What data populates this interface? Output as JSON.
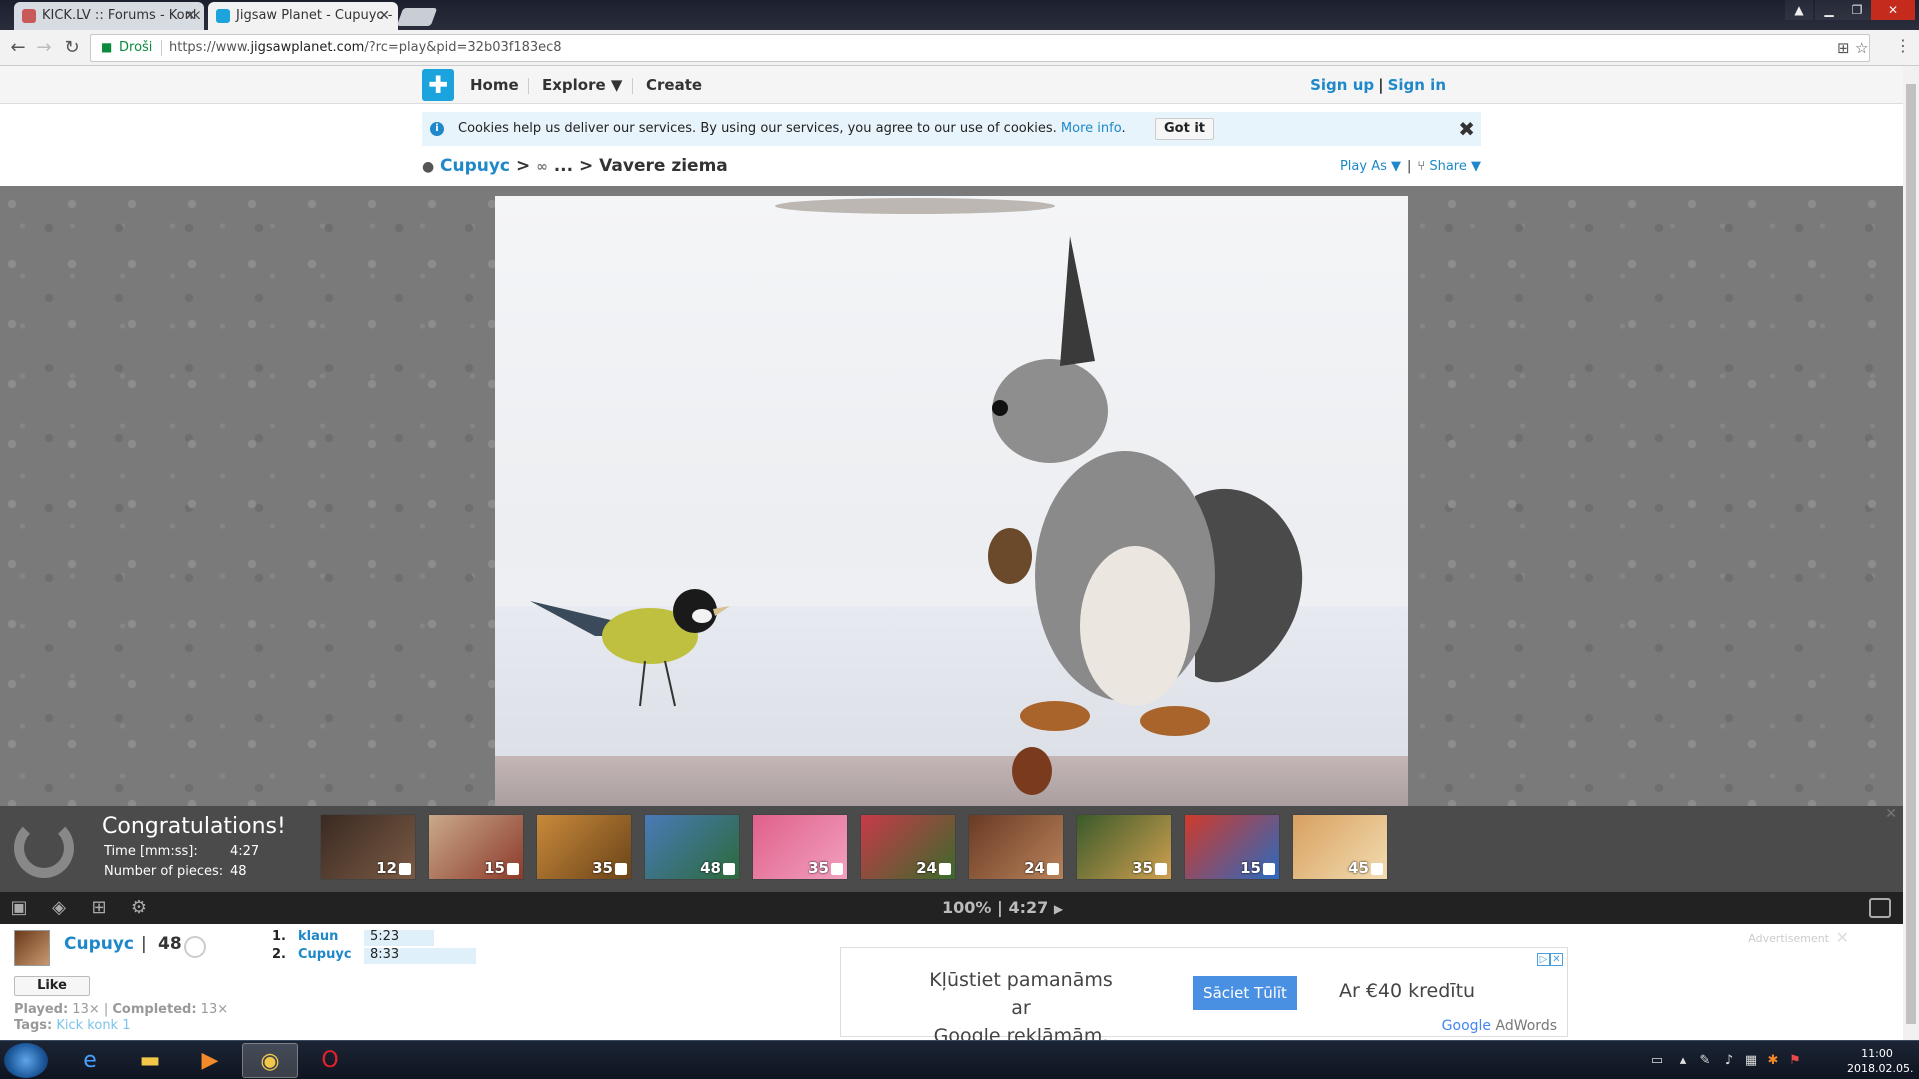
{
  "browser": {
    "tabs": [
      {
        "title": "KICK.LV :: Forums - Konk",
        "active": false
      },
      {
        "title": "Jigsaw Planet - Cupuyc - ",
        "active": true
      }
    ],
    "secure_label": "Droši",
    "url_prefix": "https://www.",
    "url_host": "jigsawplanet.com",
    "url_path": "/?rc=play&pid=32b03f183ec8"
  },
  "site": {
    "nav": {
      "home": "Home",
      "explore": "Explore ▼",
      "create": "Create"
    },
    "auth": {
      "sign_up": "Sign up",
      "separator": "|",
      "sign_in": "Sign in"
    }
  },
  "cookie": {
    "text": "Cookies help us deliver our services. By using our services, you agree to our use of cookies.",
    "more": "More info",
    "more_suffix": ".",
    "button": "Got it",
    "close": "✖"
  },
  "breadcrumb": {
    "user": "Cupuyc",
    "gt1": ">",
    "ellipsis": "...",
    "gt2": ">",
    "title": "Vavere ziema",
    "play_as": "Play As ▼",
    "separator": "|",
    "share": "Share ▼"
  },
  "congrats": {
    "title": "Congratulations!",
    "time_label": "Time [mm:ss]:",
    "time_value": "4:27",
    "pieces_label": "Number of pieces:",
    "pieces_value": "48",
    "thumbnails": [
      {
        "count": "12",
        "colors": [
          "#3a2a22",
          "#7a5a44"
        ]
      },
      {
        "count": "15",
        "colors": [
          "#caa98a",
          "#8c3a2a"
        ]
      },
      {
        "count": "35",
        "colors": [
          "#c98a3a",
          "#6a4318"
        ]
      },
      {
        "count": "48",
        "colors": [
          "#4a7ab8",
          "#2a6a3a"
        ]
      },
      {
        "count": "35",
        "colors": [
          "#e0608a",
          "#f2a0c0"
        ]
      },
      {
        "count": "24",
        "colors": [
          "#c83a4a",
          "#3a6a2a"
        ]
      },
      {
        "count": "24",
        "colors": [
          "#6a3a24",
          "#b8825a"
        ]
      },
      {
        "count": "35",
        "colors": [
          "#3a5a2a",
          "#d0a050"
        ]
      },
      {
        "count": "15",
        "colors": [
          "#d03a2a",
          "#2a6ac0"
        ]
      },
      {
        "count": "45",
        "colors": [
          "#d8a060",
          "#f2dcb0"
        ]
      }
    ]
  },
  "toolbar": {
    "zoom": "100%",
    "separator": "|",
    "timer": "4:27",
    "play": "▶"
  },
  "info": {
    "owner": "Cupuyc",
    "separator": "|",
    "puzzle_count": "48",
    "like": "Like",
    "played_label": "Played:",
    "played_value": "13×",
    "completed_label": "Completed:",
    "completed_value": "13×",
    "tags_label": "Tags:",
    "tags_value": "Kick konk 1",
    "scores": [
      {
        "rank": "1.",
        "name": "klaun",
        "time": "5:23",
        "bar": 0.5
      },
      {
        "rank": "2.",
        "name": "Cupuyc",
        "time": "8:33",
        "bar": 0.8
      }
    ]
  },
  "ad": {
    "label": "Advertisement",
    "line1": "Kļūstiet pamanāms ar",
    "line2": "Google reklāmām.",
    "button": "Sāciet Tūlīt",
    "credit": "Ar €40 kredītu",
    "brand_google": "Google",
    "brand_adwords": " AdWords"
  },
  "taskbar": {
    "clock_time": "11:00",
    "clock_date": "2018.02.05."
  }
}
